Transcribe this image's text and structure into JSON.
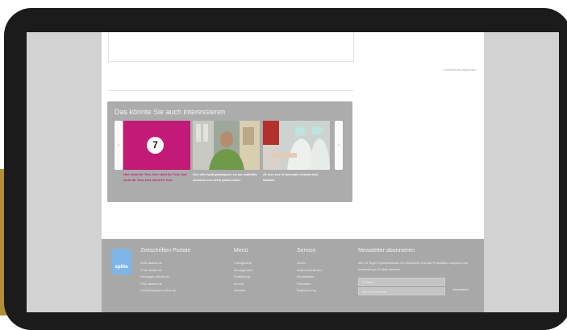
{
  "article": {
    "comment_link": "› Kommentar absenden"
  },
  "related": {
    "title": "Das könnte Sie auch interessieren",
    "prev_arrow": "‹",
    "next_arrow": "›",
    "cards": [
      {
        "caption": "Hier steht Ihr Text, hier steht Ihr Text, hier steht Ihr Text, hier steht Ihr Text",
        "badge": "7",
        "color": "#c21a76"
      },
      {
        "caption": "Sen ollis bodi gutempore, no wo rubinatis suessus ed Lorem ipsum dolor"
      },
      {
        "caption": "At vero eos et accusam et justo duo dolores"
      }
    ]
  },
  "footer": {
    "logo": "spitta",
    "portale": {
      "title": "Zeitschriften Portale",
      "items": [
        "ZMK-aktuell.de",
        "ZTM-aktuell.de",
        "Dentagen-aktuell.de",
        "PMZ-aktuell.de",
        "Dentalkompakt-online.de"
      ]
    },
    "menu": {
      "title": "Menü",
      "items": [
        "Fachgebiete",
        "Management",
        "Fortbildung",
        "Events",
        "Infothek"
      ]
    },
    "service": {
      "title": "Service",
      "items": [
        "Archiv",
        "Autorenrichtlinien",
        "Mediadaten",
        "Probeabo",
        "Registrierung"
      ]
    },
    "newsletter": {
      "title": "Newsletter abonnieren",
      "text": "Alle 14 Tage Expertenwissen für Zahnärzte und das Praxisteam bequem und kostenlos per E-Mail erhalten",
      "name_placeholder": "Ihr Name",
      "email_placeholder": "Ihre E-Mail-Adresse",
      "submit": "Abonnieren"
    }
  },
  "colors": {
    "frame": "#1b1b1b",
    "accent": "#c21a76",
    "footer": "#a8a8a8",
    "logo": "#7db6e6"
  }
}
